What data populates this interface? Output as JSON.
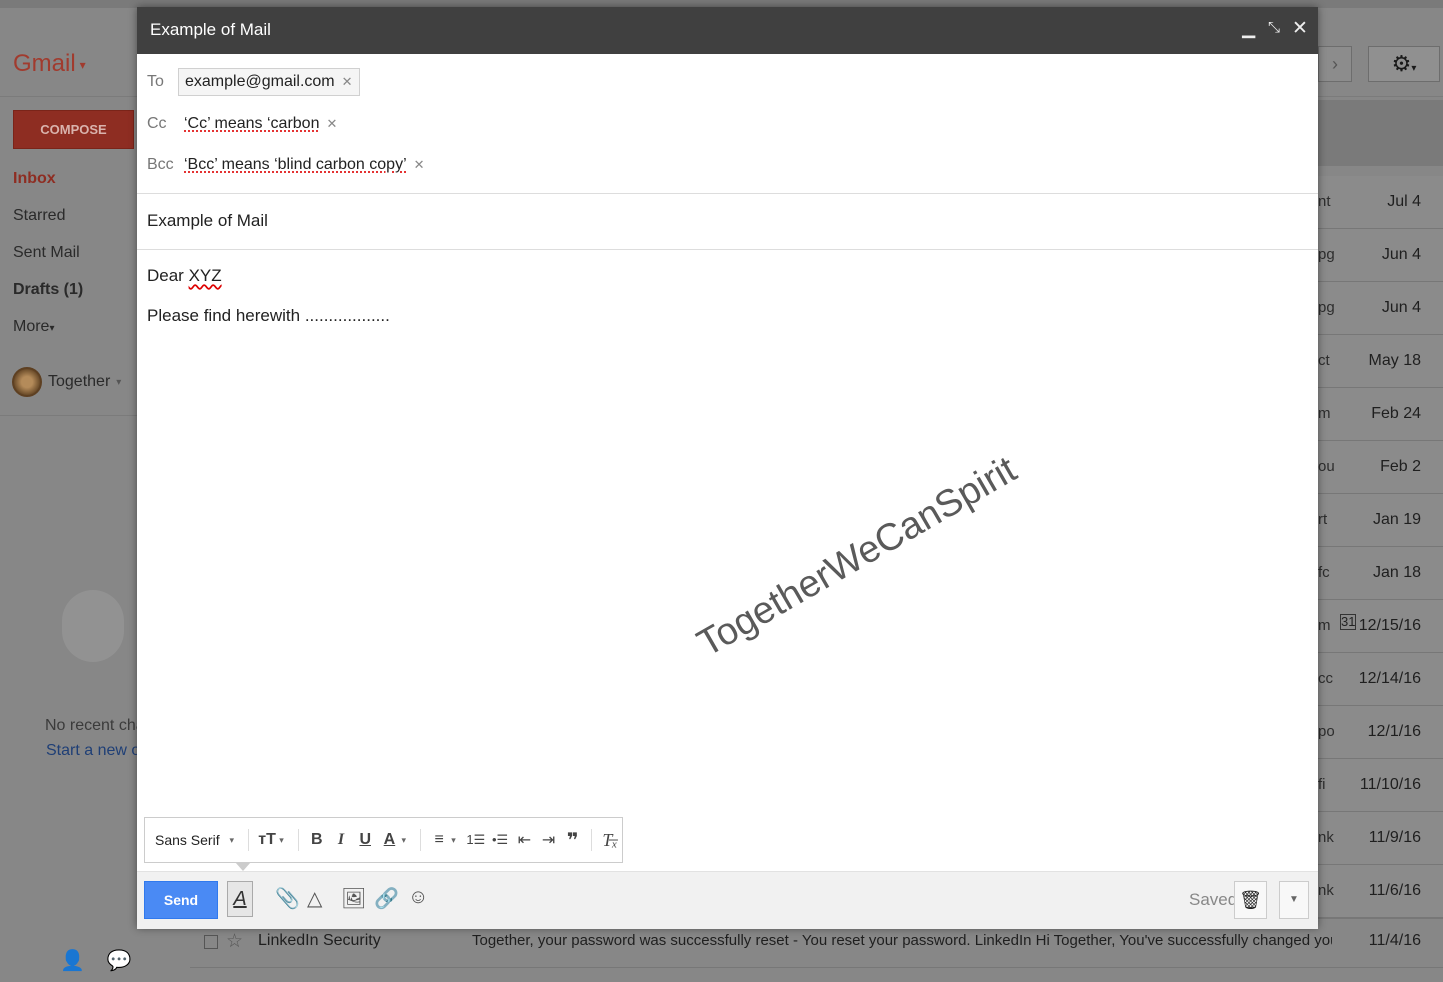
{
  "background": {
    "logo": "Gmail",
    "compose_label": "COMPOSE",
    "nav": [
      "Inbox",
      "Starred",
      "Sent Mail",
      "Drafts (1)",
      "More"
    ],
    "account_name": "Together",
    "chat_empty": "No recent chats",
    "chat_start": "Start a new one",
    "mail_rows": [
      {
        "frag": "nt",
        "date": "Jul 4"
      },
      {
        "frag": "pg",
        "date": "Jun 4"
      },
      {
        "frag": "pg",
        "date": "Jun 4"
      },
      {
        "frag": "ct",
        "date": "May 18"
      },
      {
        "frag": "m",
        "date": "Feb 24"
      },
      {
        "frag": "ou",
        "date": "Feb 2"
      },
      {
        "frag": "rt",
        "date": "Jan 19"
      },
      {
        "frag": "fc",
        "date": "Jan 18"
      },
      {
        "frag": "m",
        "date": "12/15/16"
      },
      {
        "frag": "cc",
        "date": "12/14/16"
      },
      {
        "frag": "po",
        "date": "12/1/16"
      },
      {
        "frag": "fi",
        "date": "11/10/16"
      },
      {
        "frag": "nk",
        "date": "11/9/16"
      },
      {
        "frag": "nk",
        "date": "11/6/16"
      }
    ],
    "last_row": {
      "sender": "LinkedIn Security",
      "snippet": "Together, your password was successfully reset - You reset your password. LinkedIn Hi Together, You've successfully changed your LinkedIn passw",
      "date": "11/4/16"
    },
    "calendar_badge": "31"
  },
  "compose": {
    "title": "Example of Mail",
    "to_label": "To",
    "to_value": "example@gmail.com",
    "cc_label": "Cc",
    "cc_value": "‘Cc’ means ‘carbon",
    "bcc_label": "Bcc",
    "bcc_value": "‘Bcc’ means ‘blind carbon copy’",
    "subject": "Example of Mail",
    "body_greeting_prefix": "Dear ",
    "body_greeting_name": "XYZ",
    "body_line2": "Please find herewith ..................",
    "watermark": "TogetherWeCanSpirit",
    "font_name": "Sans Serif",
    "send_label": "Send",
    "saved_label": "Saved"
  },
  "icons": {
    "minimize": "minimize-icon",
    "popout": "popout-icon",
    "close": "close-icon",
    "attach": "paperclip-icon",
    "drive": "drive-icon",
    "photo": "photo-icon",
    "link": "link-icon",
    "emoji": "emoji-icon",
    "trash": "trash-icon"
  },
  "colors": {
    "send_button": "#4a8af4",
    "titlebar": "#404040",
    "compose_button": "#8e2d22"
  }
}
